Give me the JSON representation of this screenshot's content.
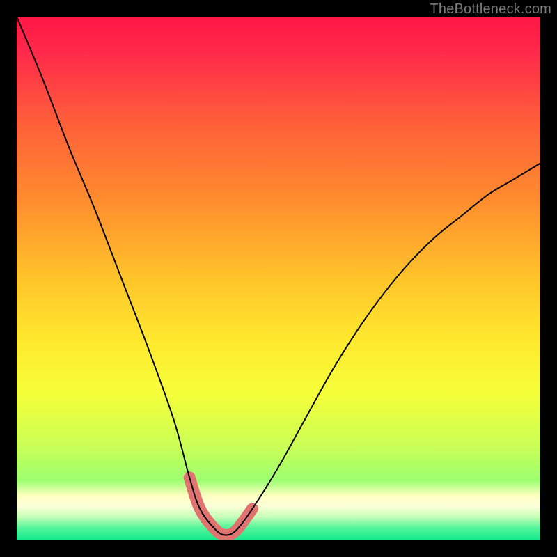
{
  "watermark": "TheBottleneck.com",
  "chart_data": {
    "type": "line",
    "title": "",
    "xlabel": "",
    "ylabel": "",
    "xlim": [
      0,
      100
    ],
    "ylim": [
      0,
      100
    ],
    "grid": false,
    "series": [
      {
        "name": "bottleneck-curve",
        "x": [
          0,
          5,
          10,
          15,
          20,
          25,
          30,
          33,
          35,
          38,
          40,
          42,
          45,
          50,
          55,
          60,
          65,
          70,
          75,
          80,
          85,
          90,
          95,
          100
        ],
        "y": [
          100,
          88,
          75,
          63,
          50,
          37,
          23,
          12,
          6,
          2,
          1,
          2,
          6,
          14,
          23,
          32,
          40,
          47,
          53,
          58,
          62,
          66,
          69,
          72
        ]
      },
      {
        "name": "highlight-band",
        "x": [
          33,
          35,
          38,
          40,
          42,
          45
        ],
        "y": [
          12,
          6,
          2,
          1,
          2,
          6
        ]
      }
    ],
    "gradient_stops": [
      {
        "offset": 0.0,
        "color": "#ff1744"
      },
      {
        "offset": 0.07,
        "color": "#ff2a4a"
      },
      {
        "offset": 0.2,
        "color": "#ff5e3a"
      },
      {
        "offset": 0.35,
        "color": "#ff8c2e"
      },
      {
        "offset": 0.5,
        "color": "#ffc42a"
      },
      {
        "offset": 0.62,
        "color": "#ffe92e"
      },
      {
        "offset": 0.72,
        "color": "#f4ff3a"
      },
      {
        "offset": 0.82,
        "color": "#caff55"
      },
      {
        "offset": 0.885,
        "color": "#9cff70"
      },
      {
        "offset": 0.915,
        "color": "#ffffc2"
      },
      {
        "offset": 0.935,
        "color": "#fbffd8"
      },
      {
        "offset": 0.955,
        "color": "#c8ffb8"
      },
      {
        "offset": 0.975,
        "color": "#58f59a"
      },
      {
        "offset": 1.0,
        "color": "#12e88c"
      }
    ],
    "highlight_color": "#e0736f",
    "curve_color": "#000000"
  }
}
